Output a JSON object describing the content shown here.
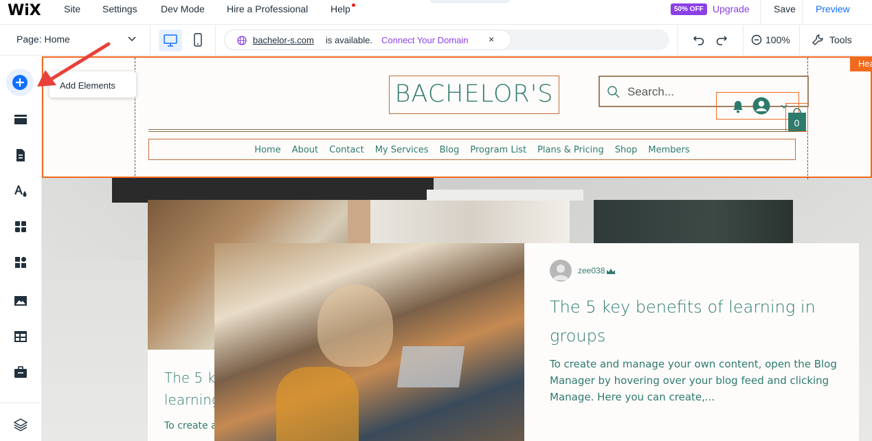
{
  "topbar": {
    "logo": "WiX",
    "menu": [
      "Site",
      "Settings",
      "Dev Mode",
      "Hire a Professional",
      "Help"
    ],
    "badge": "50% OFF",
    "upgrade": "Upgrade",
    "save": "Save",
    "preview": "Preview"
  },
  "toolbar": {
    "page_select": "Page: Home",
    "domain_name": "bachelor-s.com",
    "domain_text": "is available.",
    "connect_link": "Connect Your Domain",
    "close": "×",
    "zoom": "100%",
    "tools": "Tools"
  },
  "sidebar": {
    "tooltip": "Add Elements",
    "icons": [
      "add-elements-icon",
      "sections-icon",
      "pages-icon",
      "design-icon",
      "apps-icon",
      "business-apps-icon",
      "media-icon",
      "cms-icon",
      "portfolio-icon",
      "layers-icon"
    ]
  },
  "site": {
    "header_tag": "Hea",
    "logo": "BACHELOR'S",
    "search_placeholder": "Search...",
    "cart_count": "0",
    "nav": [
      "Home",
      "About",
      "Contact",
      "My Services",
      "Blog",
      "Program List",
      "Plans & Pricing",
      "Shop",
      "Members"
    ]
  },
  "post": {
    "author": "zee038",
    "title": "The 5 key benefits of learning in groups",
    "excerpt": "To create and manage your own content, open the Blog Manager by hovering over your blog feed and clicking Manage. Here you can create,...",
    "back_title_1": "The 5 ke",
    "back_title_2": "learning",
    "back_excerpt": "To create a"
  },
  "colors": {
    "accent": "#116dff",
    "purple": "#8b40e6",
    "selection": "#f06a1e",
    "site_teal": "#2e7a6c",
    "arrow": "#e8403a"
  }
}
